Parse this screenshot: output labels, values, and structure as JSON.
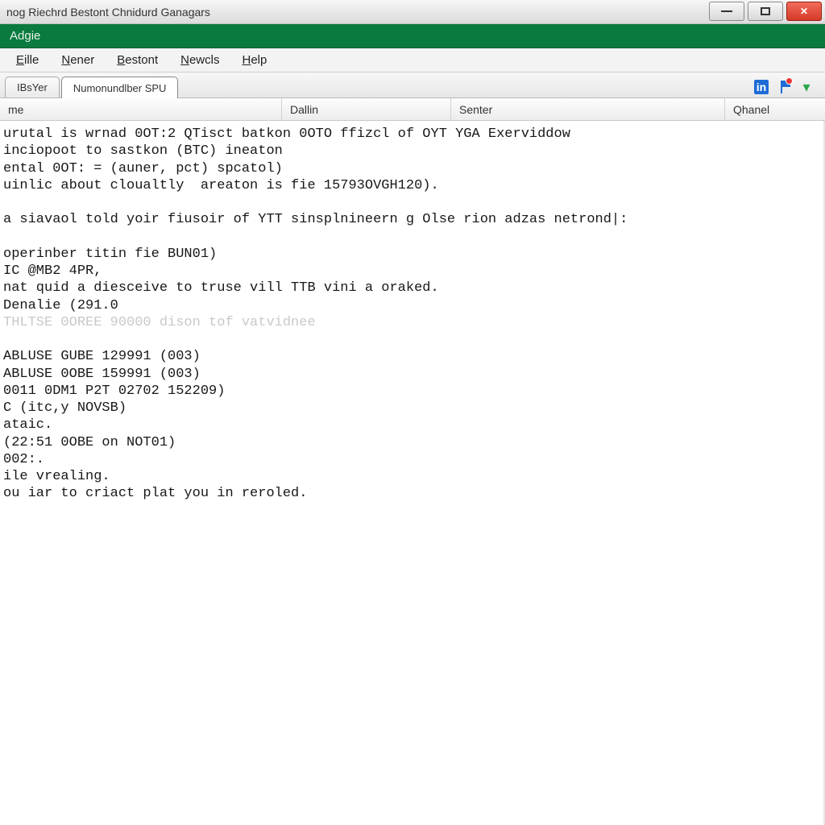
{
  "window": {
    "title": "nog Riechrd Bestont Chnidurd Ganagars"
  },
  "brand": "Adgie",
  "menu": {
    "items": [
      {
        "label": "Eille",
        "ul": "E"
      },
      {
        "label": "Nener",
        "ul": "N"
      },
      {
        "label": "Bestont",
        "ul": "B"
      },
      {
        "label": "Newcls",
        "ul": "N"
      },
      {
        "label": "Help",
        "ul": "H"
      }
    ]
  },
  "tabs": {
    "items": [
      {
        "label": "IBsYer",
        "active": false
      },
      {
        "label": "Numonundlber SPU",
        "active": true
      }
    ]
  },
  "toolbar_icons": {
    "in_icon": "in",
    "down_glyph": "▾"
  },
  "columns": [
    "me",
    "Dallin",
    "Senter",
    "Qhanel"
  ],
  "body": {
    "lines": [
      "urutal is wrnad 0OT:2 QTisct batkon 0OTO ffizcl of OYT YGA Exerviddow",
      "inciopoot to sastkon (BTC) ineaton",
      "ental 0OT: = (auner, pct) spcatol)",
      "uinlic about cloualtly  areaton is fie 15793OVGH120).",
      "",
      "a siavaol told yoir fiusoir of YTT sinsplnineern g Olse rion adzas netrond|:",
      "",
      "operinber titin fie BUN01)",
      "IC @MB2 4PR,",
      "nat quid a diesceive to truse vill TTB vini a oraked.",
      "Denalie (291.0",
      "",
      "ABLUSE GUBE 129991 (003)",
      "ABLUSE 0OBE 159991 (003)",
      "0011 0DM1 P2T 02702 152209)",
      "C (itc,y NOVSB)",
      "ataic.",
      "(22:51 0OBE on NOT01)",
      "002:.",
      "ile vrealing.",
      "ou iar to criact plat you in reroled."
    ],
    "faded_line": "THLTSE 0OREE 90000 dison tof vatvidnee"
  }
}
